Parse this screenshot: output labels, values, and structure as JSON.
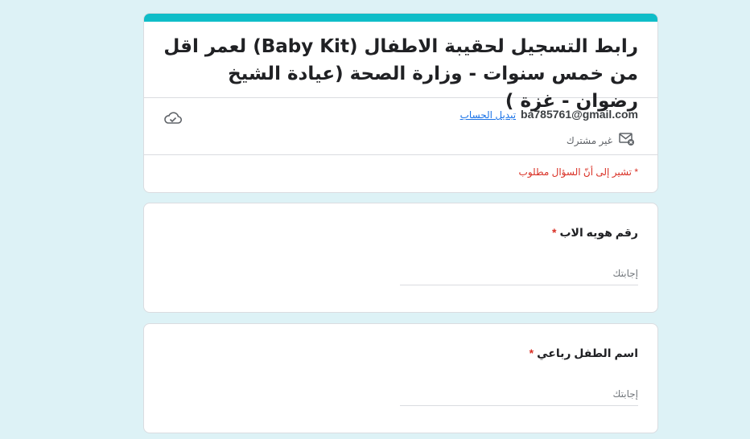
{
  "form": {
    "title": "رابط التسجيل لحقيبة الاطفال (Baby Kit) لعمر اقل من خمس سنوات - وزارة الصحة (عيادة الشيخ رضوان - غزة )",
    "accent_color": "#0fbdc8"
  },
  "account": {
    "email": "ba785761@gmail.com",
    "switch_label": "تبديل الحساب",
    "not_shared_label": "غير مشترك",
    "icons": {
      "save_status": "cloud-check-icon",
      "not_shared": "mail-off-icon"
    }
  },
  "required_note": "* تشير إلى أنّ السؤال مطلوب",
  "questions": [
    {
      "label": "رقم هويه الاب",
      "required_mark": "*",
      "placeholder": "إجابتك"
    },
    {
      "label": "اسم الطفل رباعي",
      "required_mark": "*",
      "placeholder": "إجابتك"
    }
  ]
}
